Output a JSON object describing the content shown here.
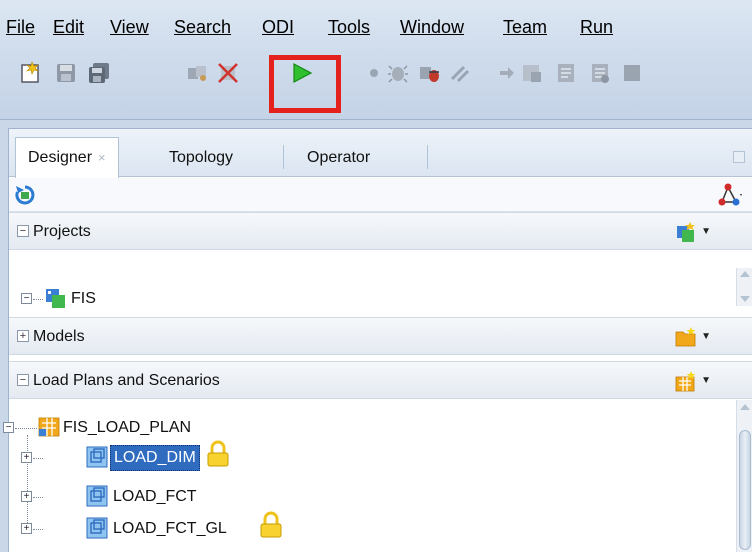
{
  "menu": {
    "file": "File",
    "edit": "Edit",
    "view": "View",
    "search": "Search",
    "odi": "ODI",
    "tools": "Tools",
    "window": "Window",
    "team": "Team",
    "run": "Run"
  },
  "toolbar": {
    "icons": [
      "new-icon",
      "save-icon",
      "save-all-icon",
      "debug-icon",
      "stop-icon",
      "run-icon",
      "breakpoint-icon",
      "bug-icon",
      "step-icon",
      "step-over-icon",
      "arrow-icon",
      "window-icon",
      "note-icon",
      "note-alt-icon",
      "more-icon"
    ],
    "highlighted": "run-icon",
    "highlight_color": "#e4211c"
  },
  "tabs": {
    "designer": "Designer",
    "designer_close": "×",
    "topology": "Topology",
    "operator": "Operator"
  },
  "accordions": {
    "projects": "Projects",
    "models": "Models",
    "load_plans": "Load Plans and Scenarios"
  },
  "projects_tree": {
    "root": "FIS"
  },
  "load_plans_tree": {
    "root": "FIS_LOAD_PLAN",
    "children": [
      {
        "label": "LOAD_DIM",
        "locked": true,
        "selected": true
      },
      {
        "label": "LOAD_FCT",
        "locked": false,
        "selected": false
      },
      {
        "label": "LOAD_FCT_GL",
        "locked": true,
        "selected": false
      }
    ]
  },
  "colors": {
    "selection": "#2f6bbf",
    "run_green": "#2fbf2f"
  }
}
